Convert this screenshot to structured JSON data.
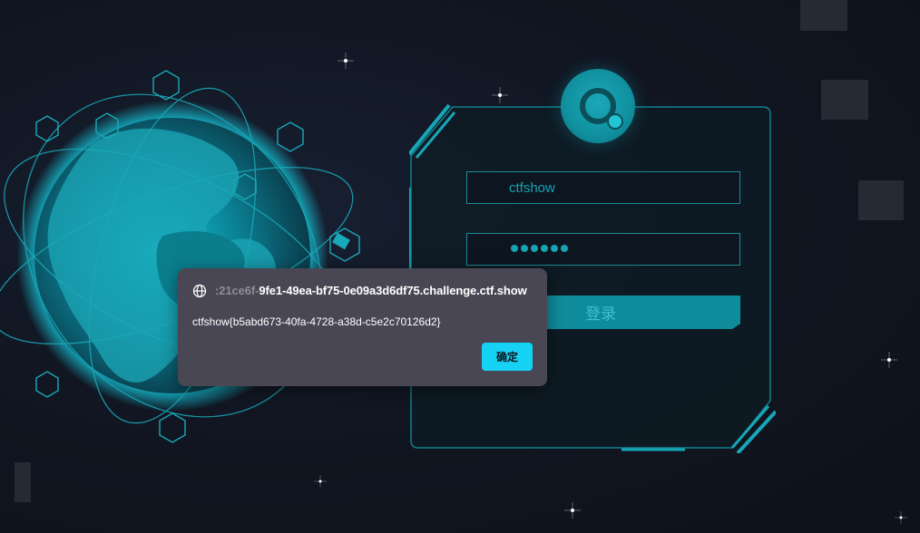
{
  "login": {
    "username_value": "ctfshow",
    "password_mask_length": 6,
    "login_button_label": "登录"
  },
  "dialog": {
    "origin_prefix": ":21ce6f-",
    "origin_main": "9fe1-49ea-bf75-0e09a3d6df75.challenge.ctf.show",
    "message": "ctfshow{b5abd673-40fa-4728-a38d-c5e2c70126d2}",
    "ok_label": "确定",
    "icon": "globe-icon"
  },
  "colors": {
    "accent": "#16d2f5",
    "teal": "#11909f",
    "dialog_bg": "#494754",
    "page_bg": "#111622"
  }
}
